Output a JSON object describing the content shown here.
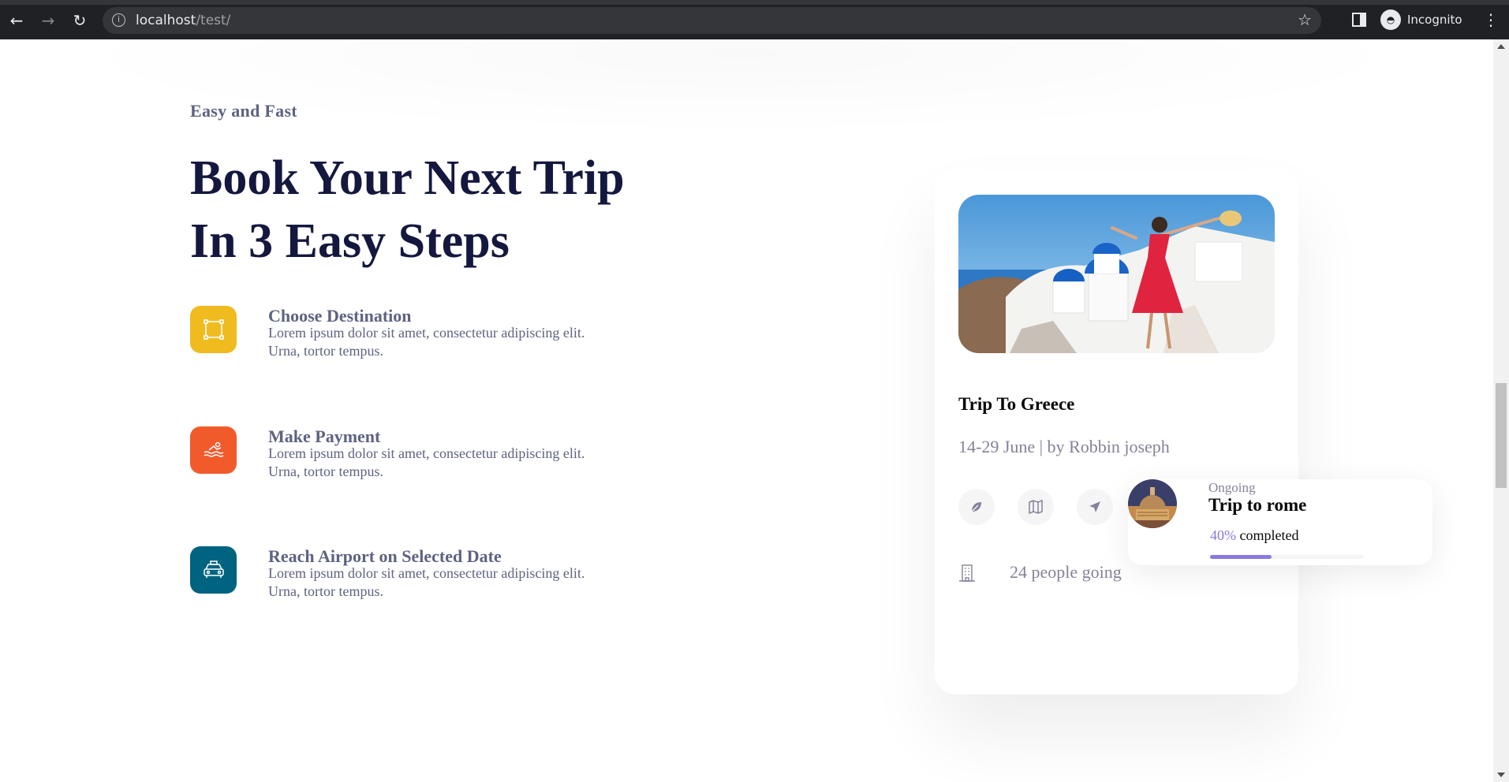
{
  "browser": {
    "url_host": "localhost",
    "url_path": "/test/",
    "profile_label": "Incognito",
    "icons": [
      "back-arrow-icon",
      "forward-arrow-icon",
      "reload-icon",
      "site-info-icon",
      "bookmark-star-icon",
      "side-panel-icon",
      "incognito-icon",
      "kebab-menu-icon"
    ]
  },
  "section": {
    "eyebrow": "Easy and Fast",
    "headline_line1": "Book Your Next Trip",
    "headline_line2": "In 3 Easy Steps",
    "steps": [
      {
        "title": "Choose Destination",
        "desc": "Lorem ipsum dolor sit amet, consectetur adipiscing elit. Urna, tortor tempus.",
        "color": "#f0bb1f",
        "icon": "selection-icon"
      },
      {
        "title": "Make Payment",
        "desc": "Lorem ipsum dolor sit amet, consectetur adipiscing elit. Urna, tortor tempus.",
        "color": "#f15a2b",
        "icon": "water-sport-icon"
      },
      {
        "title": "Reach Airport on Selected Date",
        "desc": "Lorem ipsum dolor sit amet, consectetur adipiscing elit. Urna, tortor tempus.",
        "color": "#006380",
        "icon": "taxi-icon"
      }
    ]
  },
  "trip_card": {
    "title": "Trip To Greece",
    "meta": "14-29 June | by Robbin joseph",
    "action_icons": [
      "leaf-icon",
      "map-icon",
      "send-icon"
    ],
    "people": "24 people going"
  },
  "ongoing": {
    "status": "Ongoing",
    "title": "Trip to rome",
    "percent_label": "40%",
    "completed_label": "completed",
    "progress": 0.4,
    "accent": "#8a79df"
  }
}
